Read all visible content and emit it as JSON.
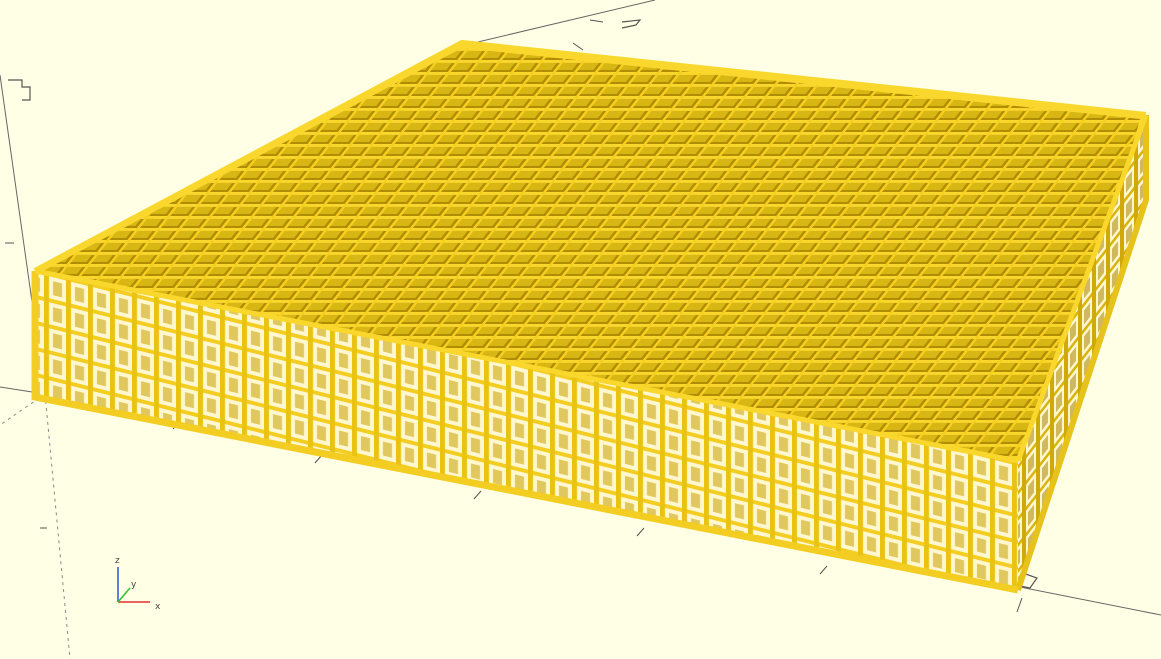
{
  "viewport": {
    "background_color": "#ffffe5",
    "model_color": "#f9d72c",
    "model_dark_color": "#c9a600",
    "model_inner_color": "#b38e00",
    "model_description": "cubic lattice"
  },
  "axes_gizmo": {
    "z_label": "z",
    "y_label": "y",
    "x_label": "x",
    "x_color": "#e03030",
    "y_color": "#30c030",
    "z_color": "#3050e0"
  }
}
